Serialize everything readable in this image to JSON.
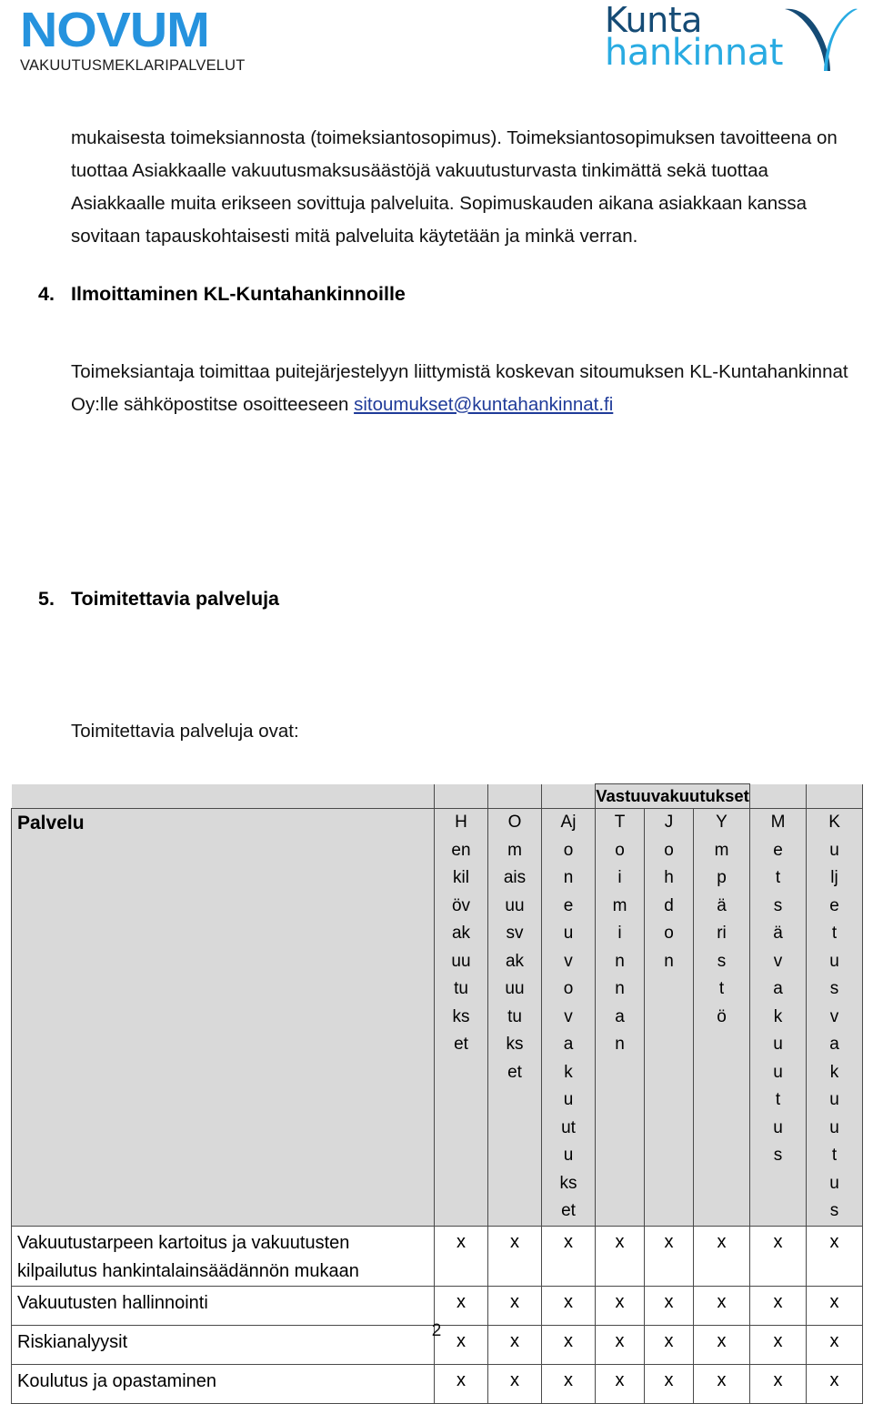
{
  "header": {
    "novum_logo": {
      "wordmark": "NOVUM",
      "tagline": "VAKUUTUSMEKLARIPALVELUT",
      "color": "#2693DE"
    },
    "kunta_logo": {
      "line1": "Kunta",
      "line2": "hankinnat",
      "line1_color": "#154B75",
      "line2_color": "#29ABE2",
      "icon": "checkmark-swoosh-icon"
    }
  },
  "body": {
    "intro_paragraph": "mukaisesta toimeksiannosta (toimeksiantosopimus). Toimeksiantosopimuksen tavoitteena on tuottaa Asiakkaalle vakuutusmaksusäästöjä vakuutusturvasta tinkimättä sekä tuottaa Asiakkaalle muita erikseen sovittuja palveluita. Sopimuskauden aikana asiakkaan kanssa sovitaan tapauskohtaisesti mitä palveluita käytetään ja minkä verran.",
    "section4": {
      "number": "4.",
      "title": "Ilmoittaminen KL-Kuntahankinnoille",
      "paragraph_before_link": "Toimeksiantaja toimittaa puitejärjestelyyn liittymistä koskevan sitoumuksen KL-Kuntahankinnat Oy:lle sähköpostitse osoitteeseen ",
      "email_link": "sitoumukset@kuntahankinnat.fi",
      "link_color": "#1F3B99"
    },
    "section5": {
      "number": "5.",
      "title": "Toimitettavia palveluja",
      "paragraph": "Toimitettavia palveluja ovat:"
    }
  },
  "table": {
    "group_header": "Vastuuvakuutukset",
    "group_span_start": 4,
    "group_span_count": 3,
    "first_column_header": "Palvelu",
    "column_headers": [
      "Henkilövakuutukset",
      "Omaisuusvakuutukset",
      "Ajoneuvovakuutukset",
      "Toiminnan",
      "Johdon",
      "Ympäristö",
      "Metsävakuutus",
      "Kuljetusvakuutus"
    ],
    "column_headers_stacked": [
      [
        "H",
        "en",
        "kil",
        "öv",
        "ak",
        "uu",
        "tu",
        "ks",
        "et"
      ],
      [
        "O",
        "m",
        "ais",
        "uu",
        "sv",
        "ak",
        "uu",
        "tu",
        "ks",
        "et"
      ],
      [
        "Aj",
        "o",
        "n",
        "e",
        "u",
        "v",
        "o",
        "v",
        "a",
        "k",
        "u",
        "ut",
        "u",
        "ks",
        "et"
      ],
      [
        "T",
        "o",
        "i",
        "m",
        "i",
        "n",
        "n",
        "a",
        "n"
      ],
      [
        "J",
        "o",
        "h",
        "d",
        "o",
        "n"
      ],
      [
        "Y",
        "m",
        "p",
        "ä",
        "ri",
        "s",
        "t",
        "ö"
      ],
      [
        "M",
        "e",
        "t",
        "s",
        "ä",
        "v",
        "a",
        "k",
        "u",
        "u",
        "t",
        "u",
        "s"
      ],
      [
        "K",
        "u",
        "lj",
        "e",
        "t",
        "u",
        "s",
        "v",
        "a",
        "k",
        "u",
        "u",
        "t",
        "u",
        "s"
      ]
    ],
    "mark": "x",
    "rows": [
      {
        "label": "Vakuutustarpeen kartoitus ja vakuutusten kilpailutus hankintalainsäädännön mukaan",
        "marks": [
          "x",
          "x",
          "x",
          "x",
          "x",
          "x",
          "x",
          "x"
        ]
      },
      {
        "label": "Vakuutusten hallinnointi",
        "marks": [
          "x",
          "x",
          "x",
          "x",
          "x",
          "x",
          "x",
          "x"
        ]
      },
      {
        "label": "Riskianalyysit",
        "marks": [
          "x",
          "x",
          "x",
          "x",
          "x",
          "x",
          "x",
          "x"
        ]
      },
      {
        "label": "Koulutus ja opastaminen",
        "marks": [
          "x",
          "x",
          "x",
          "x",
          "x",
          "x",
          "x",
          "x"
        ]
      }
    ],
    "header_bg": "#d9d9d9",
    "border_color": "#4a4a4a"
  },
  "footer": {
    "page_number": "2"
  }
}
